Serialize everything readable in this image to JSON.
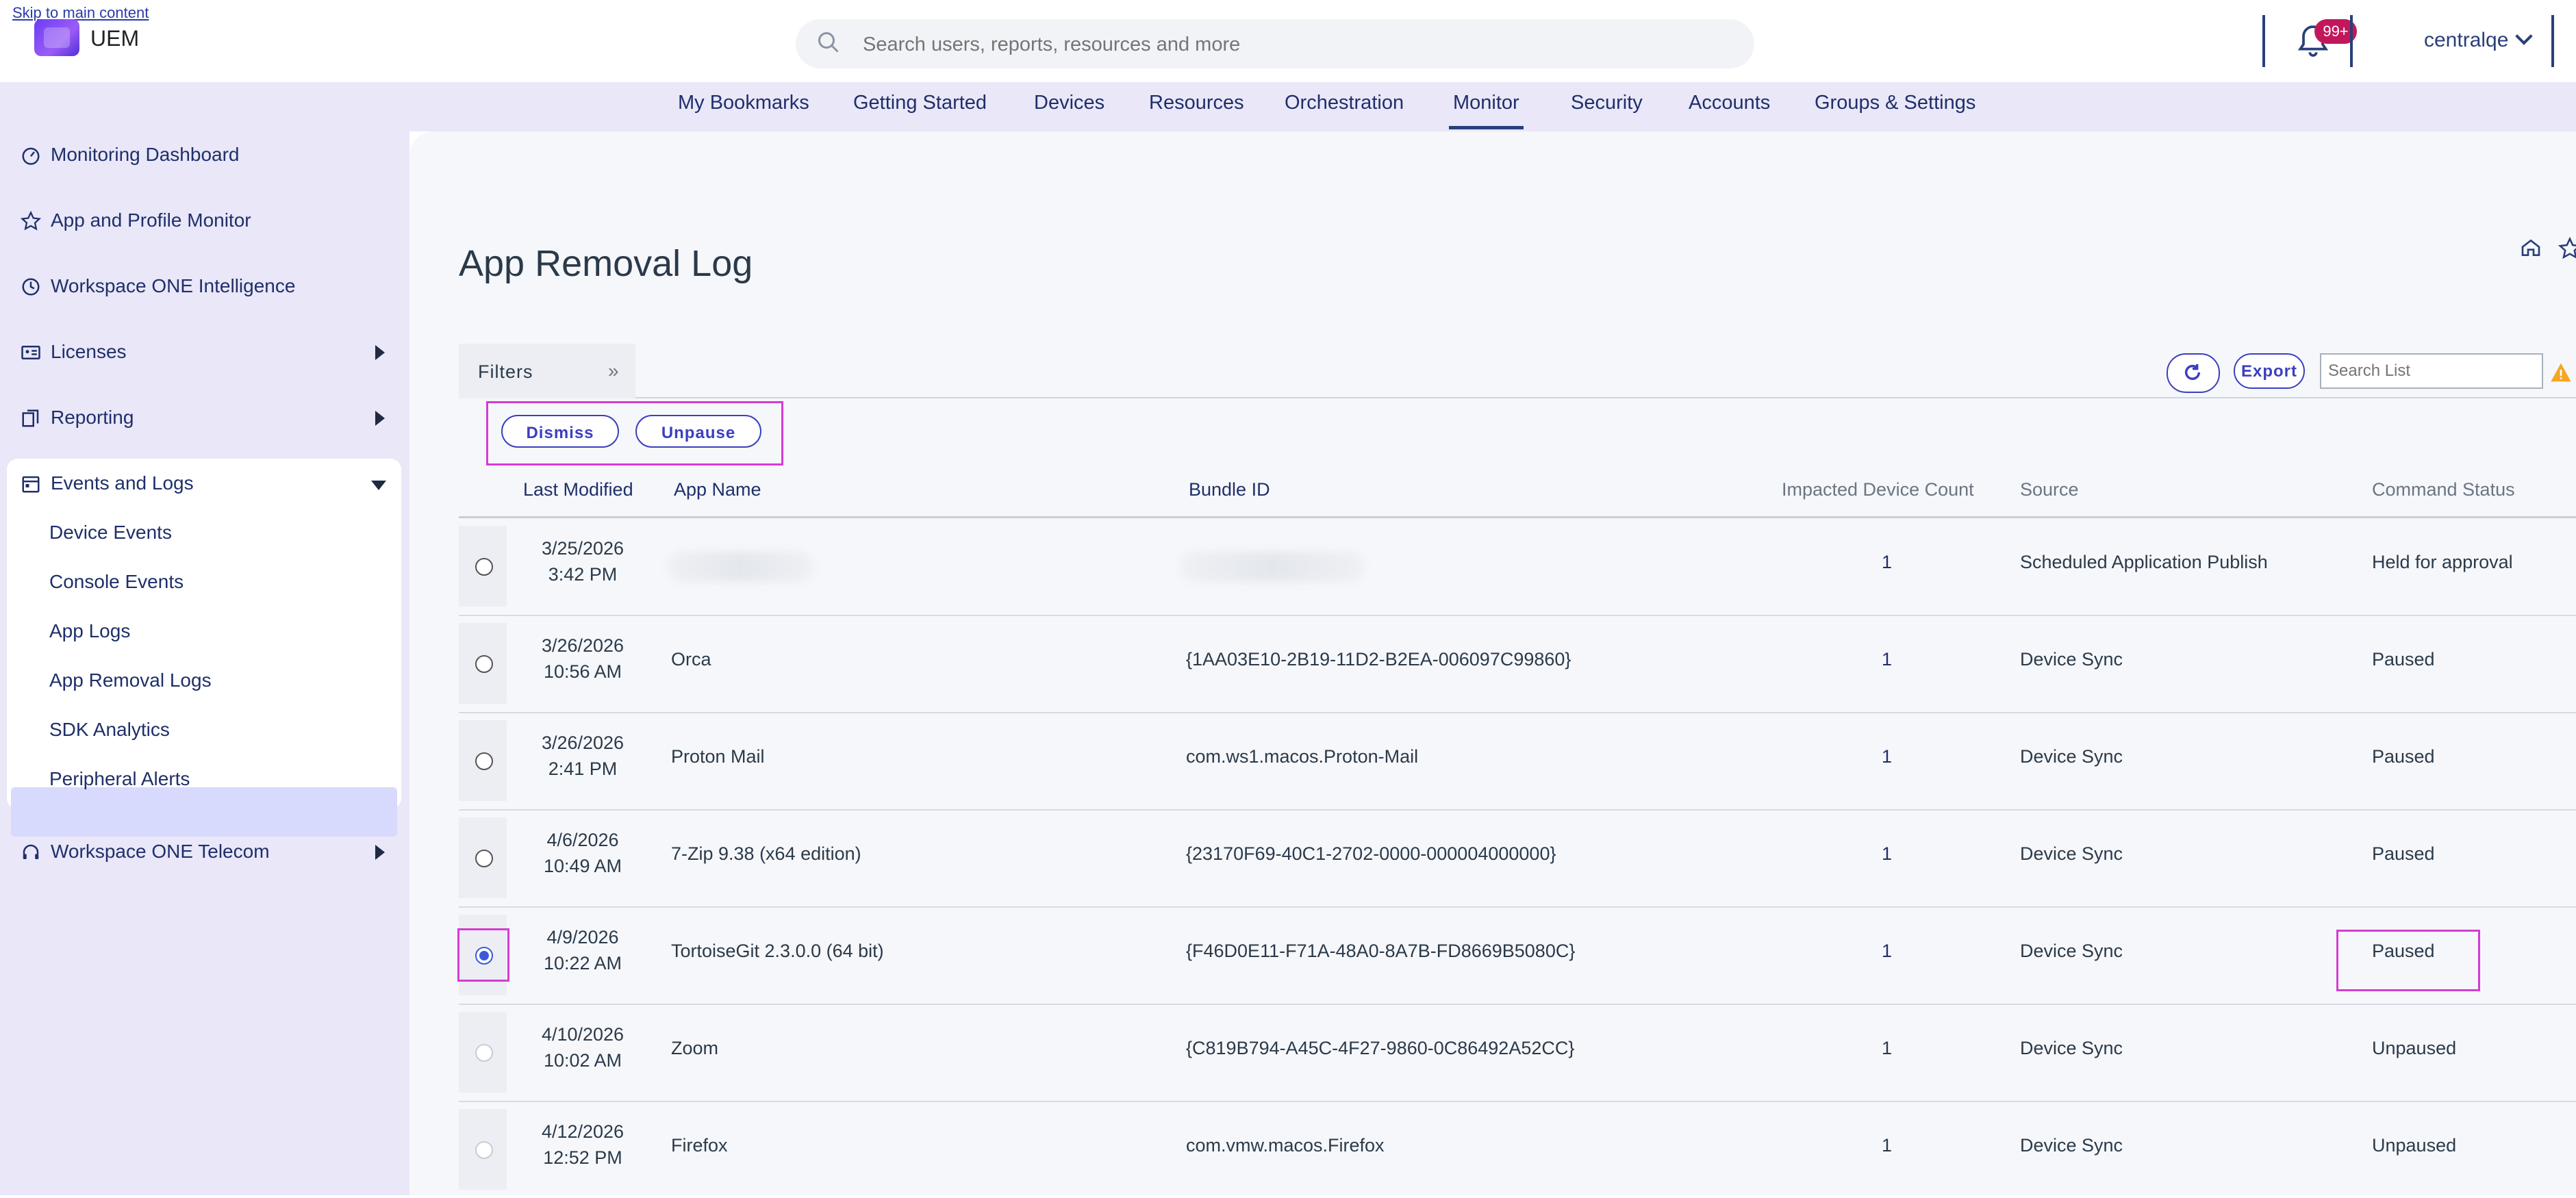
{
  "skip_link": "Skip to main content",
  "app": {
    "name": "UEM"
  },
  "search": {
    "placeholder": "Search users, reports, resources and more"
  },
  "notifications": {
    "badge": "99+"
  },
  "user": {
    "name": "centralqe"
  },
  "nav": [
    "My Bookmarks",
    "Getting Started",
    "Devices",
    "Resources",
    "Orchestration",
    "Monitor",
    "Security",
    "Accounts",
    "Groups & Settings"
  ],
  "nav_active": "Monitor",
  "sidebar": {
    "items": [
      {
        "label": "Monitoring Dashboard",
        "icon": "gauge-icon"
      },
      {
        "label": "App and Profile Monitor",
        "icon": "star-outline-icon"
      },
      {
        "label": "Workspace ONE Intelligence",
        "icon": "clock-icon"
      },
      {
        "label": "Licenses",
        "icon": "id-card-icon"
      },
      {
        "label": "Reporting",
        "icon": "report-icon"
      },
      {
        "label": "Events and Logs",
        "icon": "calendar-icon"
      },
      {
        "label": "Workspace ONE Telecom",
        "icon": "headset-icon"
      }
    ],
    "sub_items": [
      "Device Events",
      "Console Events",
      "App Logs",
      "App Removal Logs",
      "SDK Analytics",
      "Peripheral Alerts"
    ],
    "active_sub": "App Removal Logs"
  },
  "page": {
    "title": "App Removal Log"
  },
  "filters": {
    "label": "Filters"
  },
  "actions": {
    "dismiss": "Dismiss",
    "unpause": "Unpause"
  },
  "toolbar": {
    "export": "Export",
    "search_placeholder": "Search List"
  },
  "table": {
    "columns": [
      "Last Modified",
      "App Name",
      "Bundle ID",
      "Impacted Device Count",
      "Source",
      "Command Status"
    ],
    "rows": [
      {
        "date": "3/25/2026",
        "time": "3:42 PM",
        "app": "",
        "bundle": "",
        "count": "1",
        "source": "Scheduled Application Publish",
        "status": "Held for approval",
        "radio": "unchecked"
      },
      {
        "date": "3/26/2026",
        "time": "10:56 AM",
        "app": "Orca",
        "bundle": "{1AA03E10-2B19-11D2-B2EA-006097C99860}",
        "count": "1",
        "source": "Device Sync",
        "status": "Paused",
        "radio": "unchecked"
      },
      {
        "date": "3/26/2026",
        "time": "2:41 PM",
        "app": "Proton Mail",
        "bundle": "com.ws1.macos.Proton-Mail",
        "count": "1",
        "source": "Device Sync",
        "status": "Paused",
        "radio": "unchecked"
      },
      {
        "date": "4/6/2026",
        "time": "10:49 AM",
        "app": "7-Zip 9.38 (x64 edition)",
        "bundle": "{23170F69-40C1-2702-0000-000004000000}",
        "count": "1",
        "source": "Device Sync",
        "status": "Paused",
        "radio": "unchecked"
      },
      {
        "date": "4/9/2026",
        "time": "10:22 AM",
        "app": "TortoiseGit 2.3.0.0 (64 bit)",
        "bundle": "{F46D0E11-F71A-48A0-8A7B-FD8669B5080C}",
        "count": "1",
        "source": "Device Sync",
        "status": "Paused",
        "radio": "checked"
      },
      {
        "date": "4/10/2026",
        "time": "10:02 AM",
        "app": "Zoom",
        "bundle": "{C819B794-A45C-4F27-9860-0C86492A52CC}",
        "count": "1",
        "source": "Device Sync",
        "status": "Unpaused",
        "radio": "disabled"
      },
      {
        "date": "4/12/2026",
        "time": "12:52 PM",
        "app": "Firefox",
        "bundle": "com.vmw.macos.Firefox",
        "count": "1",
        "source": "Device Sync",
        "status": "Unpaused",
        "radio": "disabled"
      }
    ]
  },
  "colors": {
    "accent": "#3b3fbf",
    "highlight": "#d43cd4",
    "nav_bg": "#e9e7f8",
    "active_sub": "#d7dafc",
    "badge": "#c2185b"
  }
}
